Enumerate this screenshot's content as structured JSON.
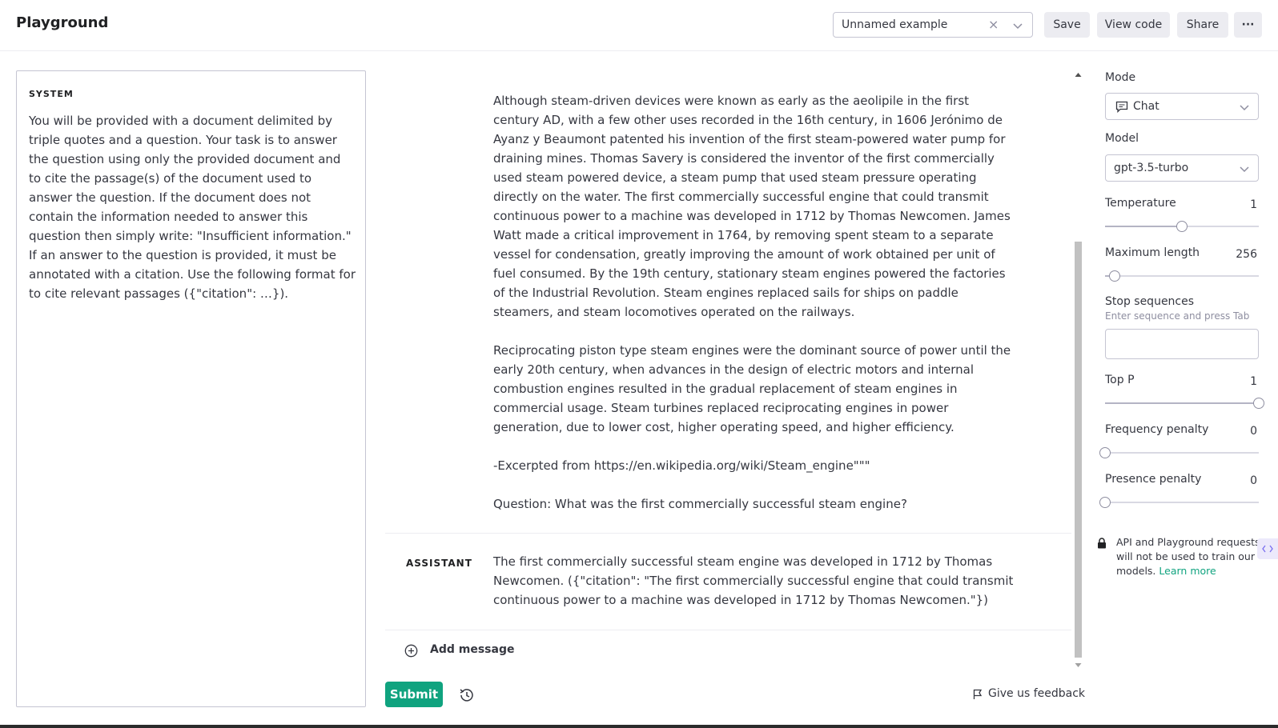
{
  "header": {
    "title": "Playground",
    "preset_value": "Unnamed example",
    "save_label": "Save",
    "view_code_label": "View code",
    "share_label": "Share",
    "more_label": "···"
  },
  "system": {
    "label": "SYSTEM",
    "text": "You will be provided with a document delimited by triple quotes and a question. Your task is to answer the question using only the provided document and to cite the passage(s) of the document used to answer the question. If the document does not contain the information needed to answer this question then simply write: \"Insufficient information.\" If an answer to the question is provided, it must be annotated with a citation. Use the following format for to cite relevant passages ({\"citation\": …})."
  },
  "user_message": {
    "paragraph1": "Although steam-driven devices were known as early as the aeolipile in the first century AD, with a few other uses recorded in the 16th century, in 1606 Jerónimo de Ayanz y Beaumont patented his invention of the first steam-powered water pump for draining mines. Thomas Savery is considered the inventor of the first commercially used steam powered device, a steam pump that used steam pressure operating directly on the water. The first commercially successful engine that could transmit continuous power to a machine was developed in 1712 by Thomas Newcomen. James Watt made a critical improvement in 1764, by removing spent steam to a separate vessel for condensation, greatly improving the amount of work obtained per unit of fuel consumed. By the 19th century, stationary steam engines powered the factories of the Industrial Revolution. Steam engines replaced sails for ships on paddle steamers, and steam locomotives operated on the railways.",
    "paragraph2": "Reciprocating piston type steam engines were the dominant source of power until the early 20th century, when advances in the design of electric motors and internal combustion engines resulted in the gradual replacement of steam engines in commercial usage. Steam turbines replaced reciprocating engines in power generation, due to lower cost, higher operating speed, and higher efficiency.",
    "paragraph3": "-Excerpted from https://en.wikipedia.org/wiki/Steam_engine\"\"\"",
    "paragraph4": "Question: What was the first commercially successful steam engine?"
  },
  "assistant_message": {
    "role": "ASSISTANT",
    "text": "The first commercially successful steam engine was developed in 1712 by Thomas Newcomen. ({\"citation\": \"The first commercially successful engine that could transmit continuous power to a machine was developed in 1712 by Thomas Newcomen.\"})"
  },
  "actions": {
    "add_message_label": "Add message",
    "submit_label": "Submit",
    "feedback_label": "Give us feedback"
  },
  "settings": {
    "mode_label": "Mode",
    "mode_value": "Chat",
    "model_label": "Model",
    "model_value": "gpt-3.5-turbo",
    "temperature_label": "Temperature",
    "temperature_value": "1",
    "temperature_fraction": 0.5,
    "max_length_label": "Maximum length",
    "max_length_value": "256",
    "max_length_fraction": 0.06,
    "stop_label": "Stop sequences",
    "stop_hint": "Enter sequence and press Tab",
    "top_p_label": "Top P",
    "top_p_value": "1",
    "top_p_fraction": 1.0,
    "freq_label": "Frequency penalty",
    "freq_value": "0",
    "freq_fraction": 0.0,
    "presence_label": "Presence penalty",
    "presence_value": "0",
    "presence_fraction": 0.0,
    "privacy_text": "API and Playground requests will not be used to train our models.",
    "learn_more": "Learn more"
  },
  "colors": {
    "accent": "#10a37f",
    "border": "#c5c5d2"
  }
}
